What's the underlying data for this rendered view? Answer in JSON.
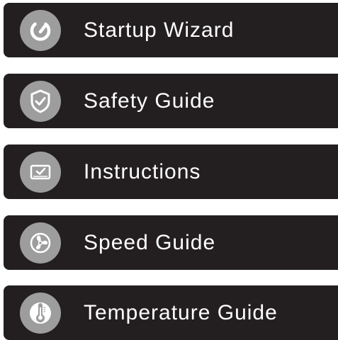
{
  "menu": {
    "items": [
      {
        "label": "Startup Wizard",
        "icon": "power-gauge-icon"
      },
      {
        "label": "Safety Guide",
        "icon": "shield-check-icon"
      },
      {
        "label": "Instructions",
        "icon": "monitor-check-icon"
      },
      {
        "label": "Speed Guide",
        "icon": "fan-icon"
      },
      {
        "label": "Temperature Guide",
        "icon": "thermometer-icon"
      }
    ]
  },
  "colors": {
    "button_background": "#231f20",
    "icon_badge": "#9d9d9d",
    "label_text": "#ffffff"
  }
}
